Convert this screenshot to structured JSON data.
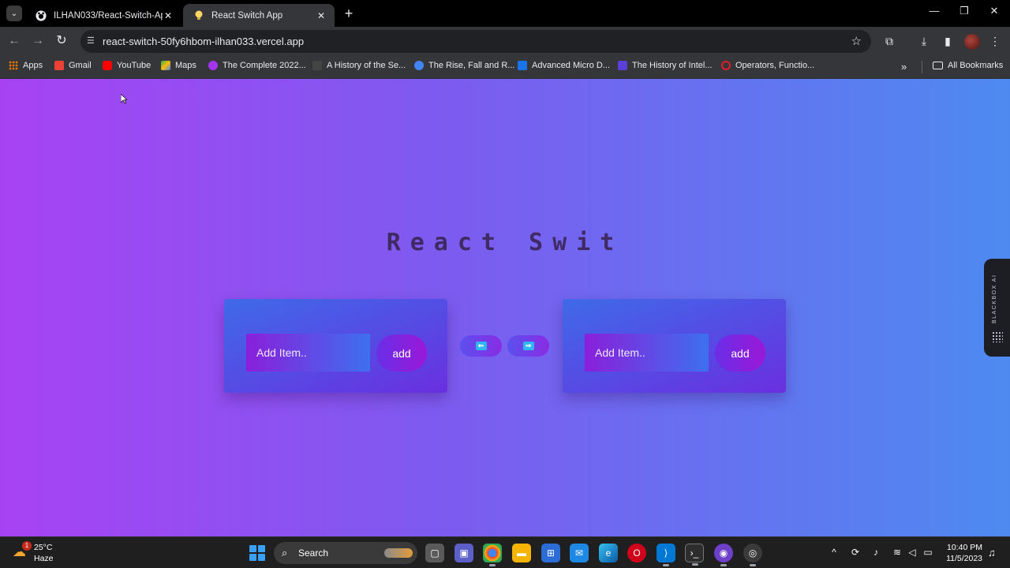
{
  "browser": {
    "tabs": [
      {
        "title": "ILHAN033/React-Switch-App",
        "icon": "github-icon",
        "active": false
      },
      {
        "title": "React Switch App",
        "icon": "lightbulb-icon",
        "active": true
      }
    ],
    "new_tab_label": "+",
    "window_controls": {
      "minimize": "—",
      "restore": "❐",
      "close": "✕"
    },
    "url": "react-switch-50fy6hbom-ilhan033.vercel.app",
    "bookmarks": [
      {
        "label": "Apps",
        "icon": "apps-grid-icon",
        "color": "#e37400"
      },
      {
        "label": "Gmail",
        "icon": "gmail-icon",
        "color": "#ea4335"
      },
      {
        "label": "YouTube",
        "icon": "youtube-icon",
        "color": "#ff0000"
      },
      {
        "label": "Maps",
        "icon": "maps-icon",
        "color": "#34a853"
      },
      {
        "label": "The Complete 2022...",
        "icon": "course-icon",
        "color": "#a435f0"
      },
      {
        "label": "A History of the Se...",
        "icon": "article-icon",
        "color": "#444444"
      },
      {
        "label": "The Rise, Fall and R...",
        "icon": "article-icon",
        "color": "#4285f4"
      },
      {
        "label": "Advanced Micro D...",
        "icon": "amd-icon",
        "color": "#1a73e8"
      },
      {
        "label": "The History of Intel...",
        "icon": "video-icon",
        "color": "#5b3fd6"
      },
      {
        "label": "Operators, Functio...",
        "icon": "oracle-icon",
        "color": "#e21d2b"
      }
    ],
    "all_bookmarks_label": "All Bookmarks"
  },
  "app": {
    "title": "React Swit",
    "left_panel": {
      "placeholder": "Add Item..",
      "button_label": "add"
    },
    "right_panel": {
      "placeholder": "Add Item..",
      "button_label": "add"
    },
    "move_left_glyph": "⇐",
    "move_right_glyph": "⇒"
  },
  "extension": {
    "label": "BLACKBOX AI"
  },
  "taskbar": {
    "weather": {
      "temp": "25°C",
      "condition": "Haze",
      "badge": "1"
    },
    "search_label": "Search",
    "clock": {
      "time": "10:40 PM",
      "date": "11/5/2023"
    }
  },
  "colors": {
    "page_gradient_start": "#a742f2",
    "page_gradient_end": "#4d8af0",
    "title_color": "#3f2a63",
    "card_gradient": "#3f6ae8",
    "button_accent": "#2fb5f0"
  }
}
